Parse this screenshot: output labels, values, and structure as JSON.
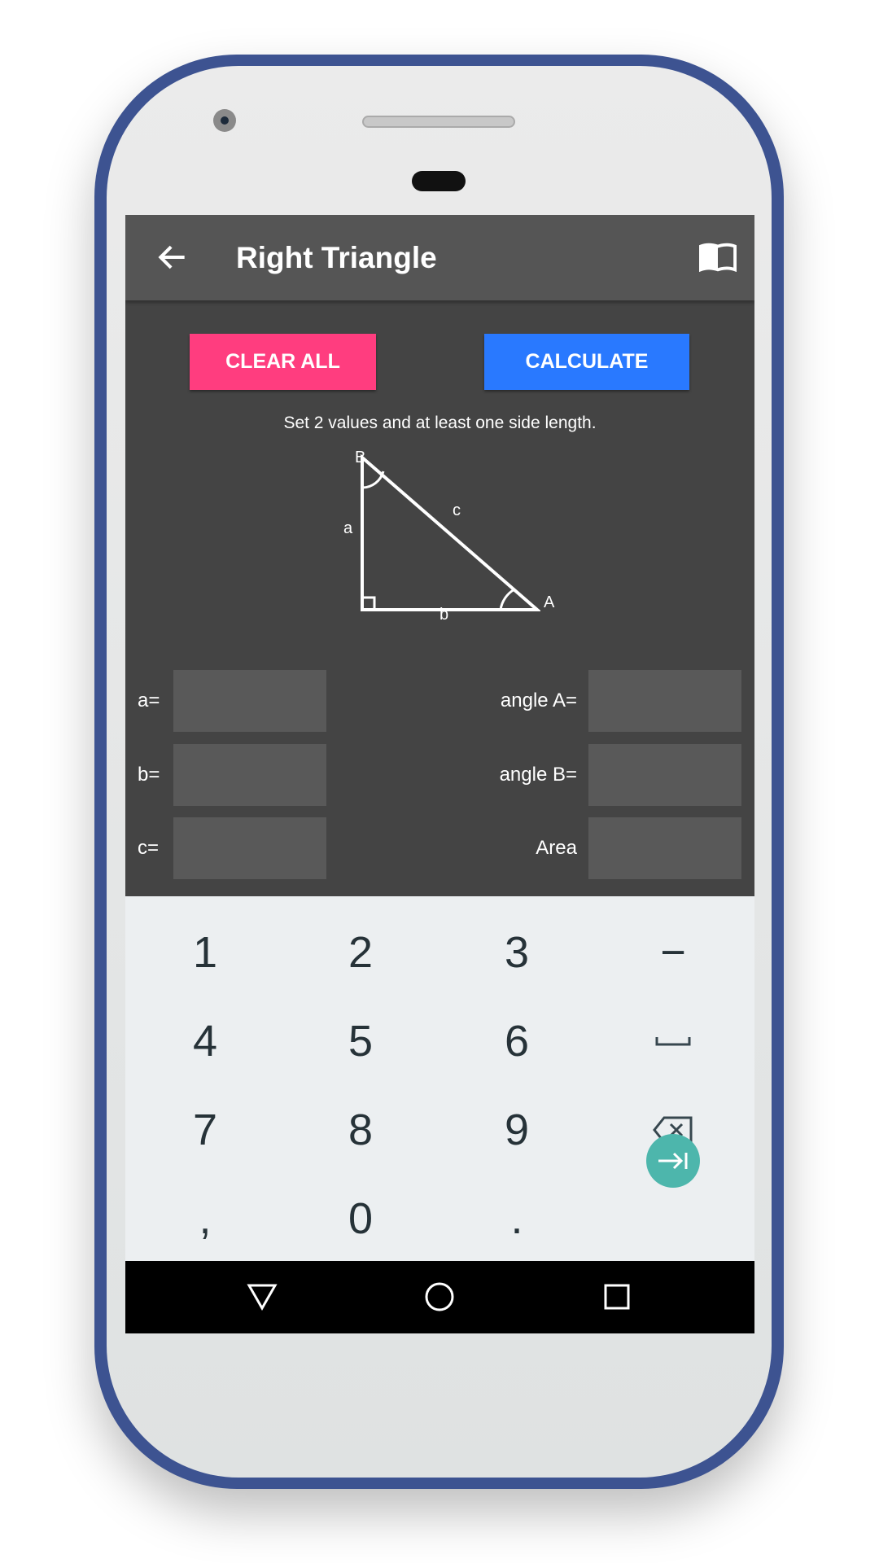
{
  "app_bar": {
    "title": "Right Triangle",
    "back_icon": "arrow-left-icon",
    "book_icon": "book-open-icon"
  },
  "buttons": {
    "clear_all": "CLEAR ALL",
    "calculate": "CALCULATE"
  },
  "colors": {
    "clear": "#ff3d7f",
    "calculate": "#2979ff",
    "enter_key": "#4db6ac",
    "frame": "#3d5391"
  },
  "instruction": "Set 2 values and at least one side length.",
  "diagram": {
    "B": "B",
    "A": "A",
    "a": "a",
    "b": "b",
    "c": "c"
  },
  "fields": {
    "left": [
      {
        "label": "a=",
        "value": ""
      },
      {
        "label": "b=",
        "value": ""
      },
      {
        "label": "c=",
        "value": ""
      }
    ],
    "right": [
      {
        "label": "angle A=",
        "value": ""
      },
      {
        "label": "angle B=",
        "value": ""
      },
      {
        "label": "Area",
        "value": ""
      }
    ]
  },
  "keyboard": {
    "rows": [
      [
        "1",
        "2",
        "3",
        "−"
      ],
      [
        "4",
        "5",
        "6",
        "space"
      ],
      [
        "7",
        "8",
        "9",
        "backspace"
      ],
      [
        ",",
        "0",
        ".",
        "next"
      ]
    ]
  }
}
